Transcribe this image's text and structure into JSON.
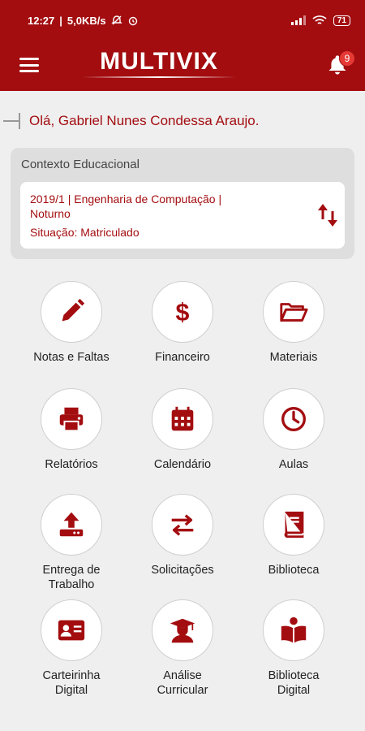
{
  "status_bar": {
    "time": "12:27",
    "net_speed": "5,0KB/s",
    "battery": "71"
  },
  "app_bar": {
    "logo": "MULTIVIX",
    "notification_count": "9"
  },
  "greeting": "Olá, Gabriel Nunes Condessa Araujo.",
  "context": {
    "title": "Contexto Educacional",
    "course_line1": "2019/1 | Engenharia de Computação |",
    "course_line2": "Noturno",
    "situation": "Situação: Matriculado"
  },
  "tiles": [
    {
      "label1": "Notas e Faltas",
      "label2": "",
      "icon": "pencil-icon"
    },
    {
      "label1": "Financeiro",
      "label2": "",
      "icon": "dollar-icon"
    },
    {
      "label1": "Materiais",
      "label2": "",
      "icon": "folder-open-icon"
    },
    {
      "label1": "Relatórios",
      "label2": "",
      "icon": "printer-icon"
    },
    {
      "label1": "Calendário",
      "label2": "",
      "icon": "calendar-icon"
    },
    {
      "label1": "Aulas",
      "label2": "",
      "icon": "clock-icon"
    },
    {
      "label1": "Entrega de",
      "label2": "Trabalho",
      "icon": "upload-icon"
    },
    {
      "label1": "Solicitações",
      "label2": "",
      "icon": "exchange-icon"
    },
    {
      "label1": "Biblioteca",
      "label2": "",
      "icon": "book-icon"
    },
    {
      "label1": "Carteirinha",
      "label2": "Digital",
      "icon": "id-card-icon"
    },
    {
      "label1": "Análise",
      "label2": "Curricular",
      "icon": "graduate-icon"
    },
    {
      "label1": "Biblioteca",
      "label2": "Digital",
      "icon": "reader-icon"
    }
  ],
  "colors": {
    "primary": "#a30d10",
    "badge": "#e53935",
    "background": "#efefef"
  }
}
